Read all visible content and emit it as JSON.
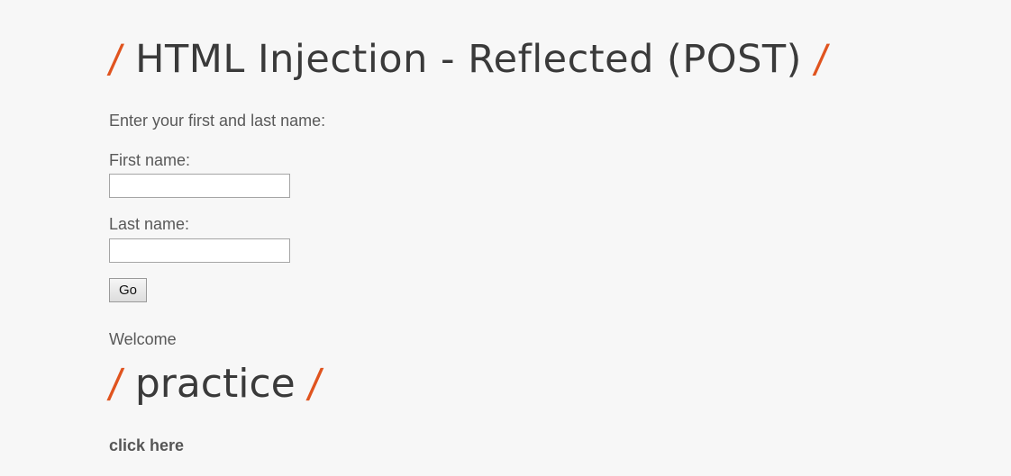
{
  "page": {
    "title": "HTML Injection - Reflected (POST)",
    "slash": "/"
  },
  "form": {
    "intro": "Enter your first and last name:",
    "first_name_label": "First name:",
    "first_name_value": "",
    "last_name_label": "Last name:",
    "last_name_value": "",
    "submit_label": "Go"
  },
  "result": {
    "welcome": "Welcome",
    "injected_heading": "practice",
    "link_text": "click here"
  },
  "colors": {
    "slash_accent": "#e0541f",
    "heading_text": "#3a3a3a",
    "body_text": "#595959",
    "background": "#f7f7f7"
  }
}
